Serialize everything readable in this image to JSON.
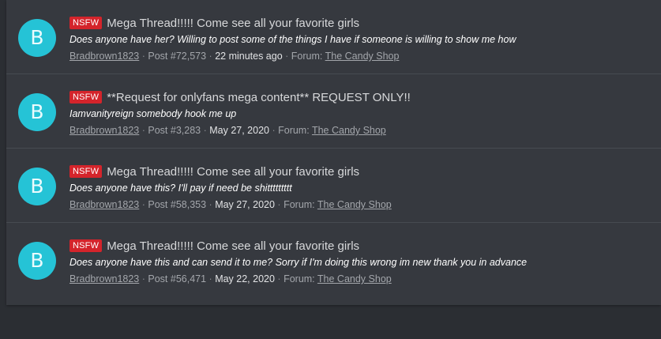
{
  "results": [
    {
      "avatar_letter": "B",
      "badge": "NSFW",
      "title": "Mega Thread!!!!! Come see all your favorite girls",
      "snippet": "Does anyone have her? Willing to post some of the things I have if someone is willing to show me how",
      "author": "Bradbrown1823",
      "post": "Post #72,573",
      "time": "22 minutes ago",
      "forum_label": "Forum:",
      "forum": "The Candy Shop"
    },
    {
      "avatar_letter": "B",
      "badge": "NSFW",
      "title": "**Request for onlyfans mega content** REQUEST ONLY!!",
      "snippet": "Iamvanityreign somebody hook me up",
      "author": "Bradbrown1823",
      "post": "Post #3,283",
      "time": "May 27, 2020",
      "forum_label": "Forum:",
      "forum": "The Candy Shop"
    },
    {
      "avatar_letter": "B",
      "badge": "NSFW",
      "title": "Mega Thread!!!!! Come see all your favorite girls",
      "snippet": "Does anyone have this? I'll pay if need be shittttttttt",
      "author": "Bradbrown1823",
      "post": "Post #58,353",
      "time": "May 27, 2020",
      "forum_label": "Forum:",
      "forum": "The Candy Shop"
    },
    {
      "avatar_letter": "B",
      "badge": "NSFW",
      "title": "Mega Thread!!!!! Come see all your favorite girls",
      "snippet": "Does anyone have this and can send it to me? Sorry if I'm doing this wrong im new thank you in advance",
      "author": "Bradbrown1823",
      "post": "Post #56,471",
      "time": "May 22, 2020",
      "forum_label": "Forum:",
      "forum": "The Candy Shop"
    }
  ],
  "separator": "·",
  "colors": {
    "page_bg": "#2b2e33",
    "panel_bg": "#36393f",
    "avatar": "#25c3d6",
    "badge": "#d4242b"
  }
}
